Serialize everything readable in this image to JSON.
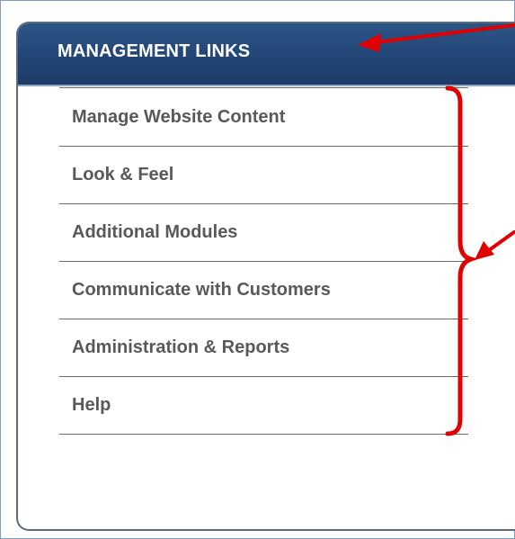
{
  "panel": {
    "title": "MANAGEMENT LINKS",
    "header_color": "#24487a"
  },
  "links": [
    {
      "label": "Manage Website Content"
    },
    {
      "label": "Look & Feel"
    },
    {
      "label": "Additional Modules"
    },
    {
      "label": "Communicate with Customers"
    },
    {
      "label": "Administration & Reports"
    },
    {
      "label": "Help"
    }
  ],
  "annotations": {
    "color": "#e00000",
    "items": [
      "arrow-to-header",
      "brace-around-links",
      "arrow-to-brace"
    ]
  }
}
